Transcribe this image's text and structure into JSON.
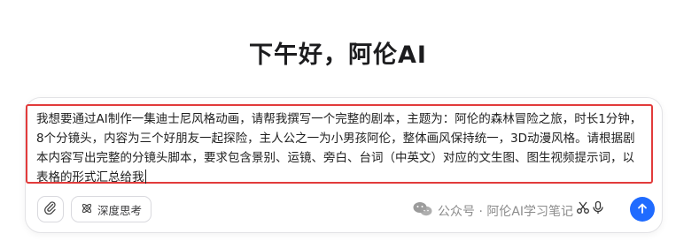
{
  "header": {
    "greeting": "下午好，阿伦AI"
  },
  "composer": {
    "prompt_text": "我想要通过AI制作一集迪士尼风格动画，请帮我撰写一个完整的剧本，主题为：阿伦的森林冒险之旅，时长1分钟，8个分镜头，内容为三个好朋友一起探险，主人公之一为小男孩阿伦，整体画风保持统一，3D动漫风格。请根据剧本内容写出完整的分镜头脚本，要求包含景别、运镜、旁白、台词（中英文）对应的文生图、图生视频提示词，以表格的形式汇总给我",
    "deep_think_label": "深度思考",
    "icons": {
      "attach": "paperclip-icon",
      "deep_think": "atom-icon",
      "scissors": "scissors-icon",
      "mic": "microphone-icon",
      "send": "arrow-up-icon"
    },
    "accent_color": "#1f6bff",
    "highlight_border_color": "#e23b3b"
  },
  "watermark": {
    "text": "公众号 · 阿伦AI学习笔记",
    "icon": "wechat-icon"
  }
}
